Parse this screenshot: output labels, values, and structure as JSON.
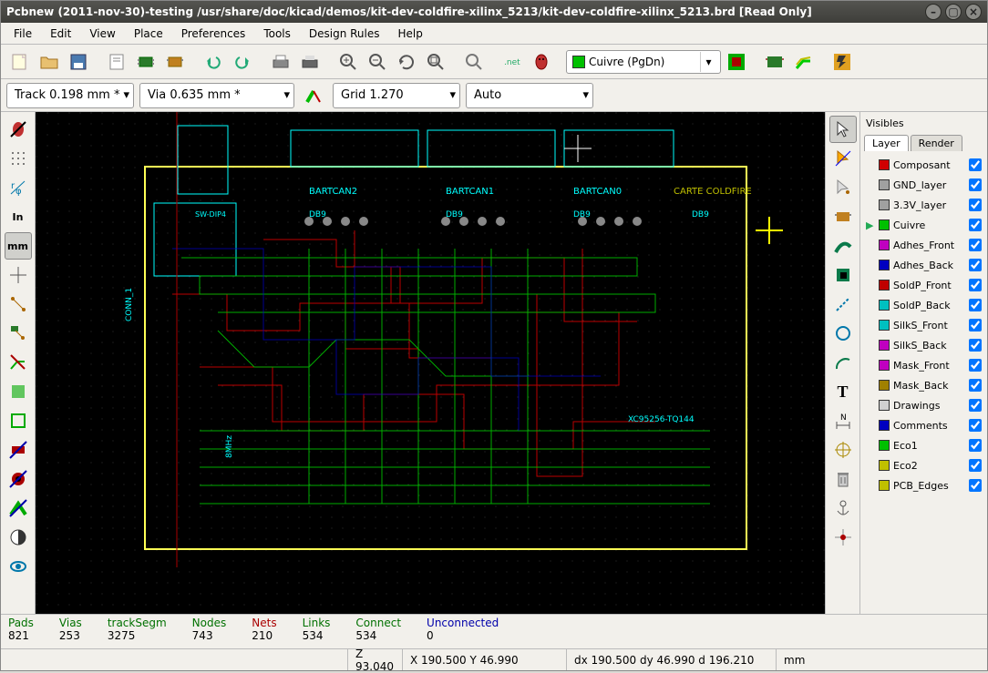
{
  "window": {
    "title": "Pcbnew (2011-nov-30)-testing /usr/share/doc/kicad/demos/kit-dev-coldfire-xilinx_5213/kit-dev-coldfire-xilinx_5213.brd [Read Only]"
  },
  "menu": [
    "File",
    "Edit",
    "View",
    "Place",
    "Preferences",
    "Tools",
    "Design Rules",
    "Help"
  ],
  "toolbar1": {
    "layer_combo": "Cuivre (PgDn)"
  },
  "toolbar2": {
    "track": "Track 0.198 mm *",
    "via": "Via 0.635 mm *",
    "grid": "Grid 1.270",
    "zoom": "Auto"
  },
  "right_panel": {
    "title": "Visibles",
    "tabs": [
      "Layer",
      "Render"
    ],
    "layers": [
      {
        "name": "Composant",
        "color": "#d00000",
        "checked": true,
        "current": false
      },
      {
        "name": "GND_layer",
        "color": "#a0a0a0",
        "checked": true,
        "current": false
      },
      {
        "name": "3.3V_layer",
        "color": "#a0a0a0",
        "checked": true,
        "current": false
      },
      {
        "name": "Cuivre",
        "color": "#00c000",
        "checked": true,
        "current": true
      },
      {
        "name": "Adhes_Front",
        "color": "#c000c0",
        "checked": true,
        "current": false
      },
      {
        "name": "Adhes_Back",
        "color": "#0000c0",
        "checked": true,
        "current": false
      },
      {
        "name": "SoldP_Front",
        "color": "#c00000",
        "checked": true,
        "current": false
      },
      {
        "name": "SoldP_Back",
        "color": "#00c0c0",
        "checked": true,
        "current": false
      },
      {
        "name": "SilkS_Front",
        "color": "#00c0c0",
        "checked": true,
        "current": false
      },
      {
        "name": "SilkS_Back",
        "color": "#c000c0",
        "checked": true,
        "current": false
      },
      {
        "name": "Mask_Front",
        "color": "#c000c0",
        "checked": true,
        "current": false
      },
      {
        "name": "Mask_Back",
        "color": "#a08000",
        "checked": true,
        "current": false
      },
      {
        "name": "Drawings",
        "color": "#d0d0d0",
        "checked": true,
        "current": false
      },
      {
        "name": "Comments",
        "color": "#0000c0",
        "checked": true,
        "current": false
      },
      {
        "name": "Eco1",
        "color": "#00c000",
        "checked": true,
        "current": false
      },
      {
        "name": "Eco2",
        "color": "#c0c000",
        "checked": true,
        "current": false
      },
      {
        "name": "PCB_Edges",
        "color": "#c0c000",
        "checked": true,
        "current": false
      }
    ]
  },
  "status1": [
    {
      "label": "Pads",
      "value": "821",
      "cls": ""
    },
    {
      "label": "Vias",
      "value": "253",
      "cls": ""
    },
    {
      "label": "trackSegm",
      "value": "3275",
      "cls": ""
    },
    {
      "label": "Nodes",
      "value": "743",
      "cls": ""
    },
    {
      "label": "Nets",
      "value": "210",
      "cls": "red"
    },
    {
      "label": "Links",
      "value": "534",
      "cls": ""
    },
    {
      "label": "Connect",
      "value": "534",
      "cls": ""
    },
    {
      "label": "Unconnected",
      "value": "0",
      "cls": "blue"
    }
  ],
  "status2": {
    "z": "Z 93.040",
    "xy": "X 190.500  Y 46.990",
    "dxy": "dx 190.500  dy 46.990  d 196.210",
    "unit": "mm"
  },
  "left_toolbar": [
    {
      "name": "drc-off-icon"
    },
    {
      "name": "grid-icon"
    },
    {
      "name": "polar-coord-icon"
    },
    {
      "name": "units-inch-icon",
      "label": "In"
    },
    {
      "name": "units-mm-icon",
      "label": "mm",
      "active": true
    },
    {
      "name": "cursor-shape-icon"
    },
    {
      "name": "ratsnest-icon"
    },
    {
      "name": "module-ratsnest-icon"
    },
    {
      "name": "auto-delete-track-icon"
    },
    {
      "name": "show-zones-icon"
    },
    {
      "name": "show-zones-outline-icon"
    },
    {
      "name": "pad-fill-icon"
    },
    {
      "name": "via-fill-icon"
    },
    {
      "name": "track-fill-icon"
    },
    {
      "name": "contrast-icon"
    },
    {
      "name": "layer-manager-icon"
    }
  ],
  "right_toolbar": [
    {
      "name": "cursor-icon",
      "active": true
    },
    {
      "name": "highlight-net-icon"
    },
    {
      "name": "local-ratsnest-icon"
    },
    {
      "name": "add-module-icon"
    },
    {
      "name": "add-track-icon"
    },
    {
      "name": "add-zone-icon"
    },
    {
      "name": "add-line-icon"
    },
    {
      "name": "add-circle-icon"
    },
    {
      "name": "add-arc-icon"
    },
    {
      "name": "add-text-icon",
      "label": "T"
    },
    {
      "name": "add-dimension-icon"
    },
    {
      "name": "add-target-icon"
    },
    {
      "name": "delete-icon"
    },
    {
      "name": "place-anchor-icon"
    },
    {
      "name": "grid-origin-icon"
    }
  ],
  "canvas_labels": {
    "bartcan2": "BARTCAN2",
    "bartcan1": "BARTCAN1",
    "bartcan0": "BARTCAN0",
    "db9a": "DB9",
    "db9b": "DB9",
    "db9c": "DB9",
    "db9d": "DB9",
    "conn": "CONN_1",
    "sw": "SW-DIP4",
    "xc": "XC95256-TQ144",
    "osc": "8MHz",
    "carte": "CARTE COLDFIRE"
  }
}
